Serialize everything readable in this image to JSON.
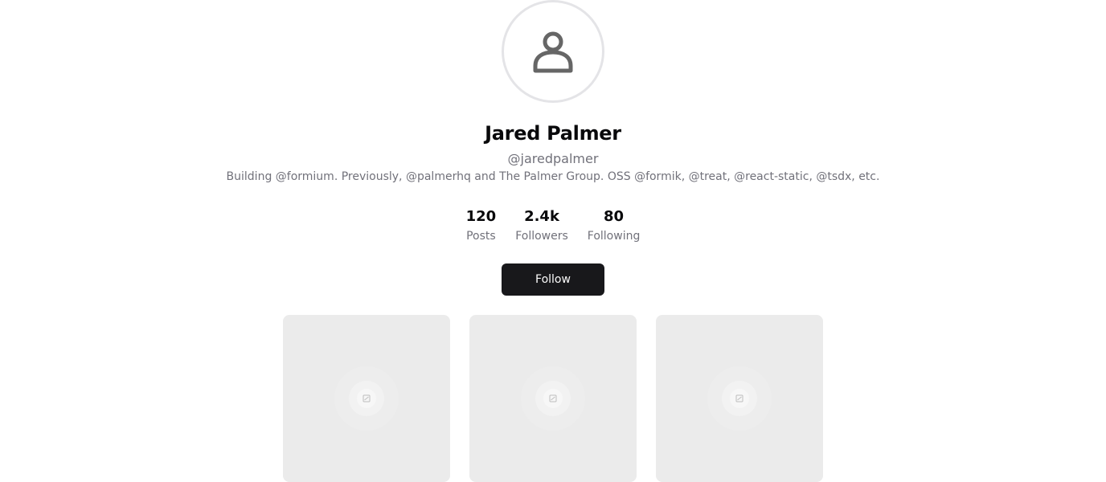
{
  "profile": {
    "name": "Jared Palmer",
    "handle": "@jaredpalmer",
    "bio": "Building @formium. Previously, @palmerhq and The Palmer Group. OSS @formik, @treat, @react-static, @tsdx, etc."
  },
  "avatar": {
    "icon": "user-icon"
  },
  "stats": [
    {
      "value": "120",
      "label": "Posts"
    },
    {
      "value": "2.4k",
      "label": "Followers"
    },
    {
      "value": "80",
      "label": "Following"
    }
  ],
  "actions": {
    "follow_label": "Follow"
  },
  "posts": [
    {
      "icon": "image-placeholder-icon"
    },
    {
      "icon": "image-placeholder-icon"
    },
    {
      "icon": "image-placeholder-icon"
    }
  ],
  "colors": {
    "primary_button": "#18181b",
    "muted_text": "#71717a",
    "tile_background": "#ebebeb",
    "avatar_border": "#e4e4e7"
  }
}
